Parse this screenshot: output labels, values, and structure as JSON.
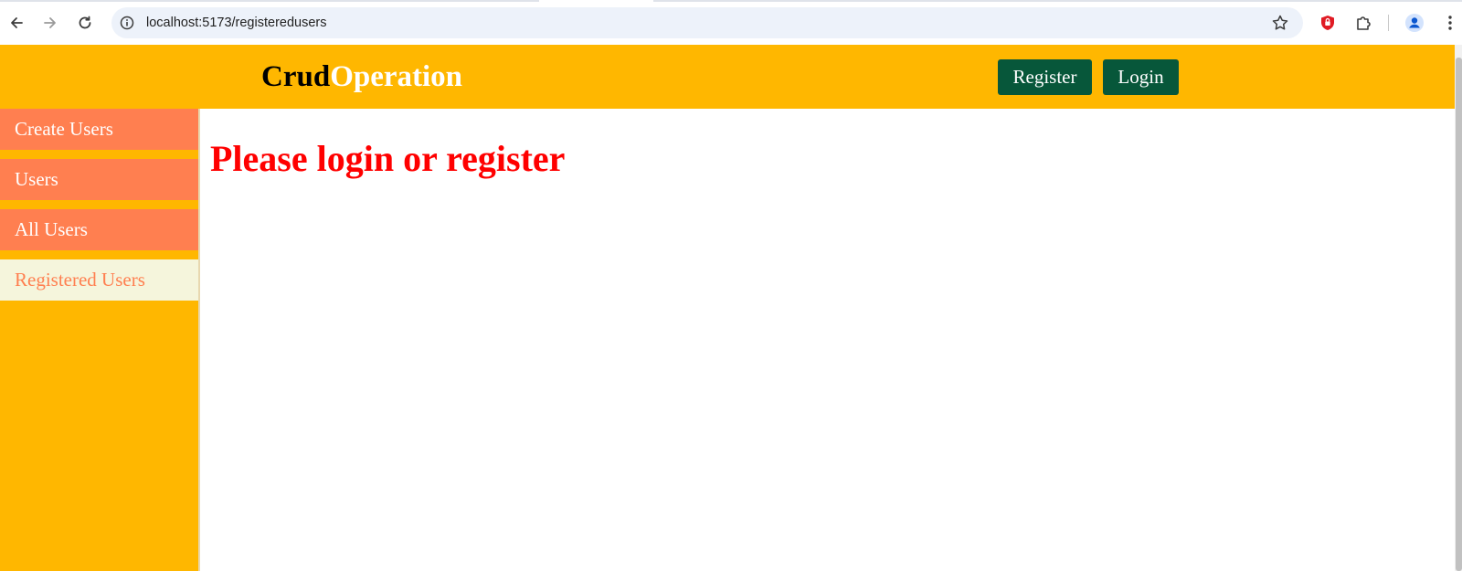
{
  "browser": {
    "url": "localhost:5173/registeredusers",
    "icons": [
      "back-arrow-icon",
      "forward-arrow-icon",
      "reload-icon",
      "site-info-icon",
      "bookmark-star-icon",
      "shield-extension-icon",
      "extensions-puzzle-icon",
      "profile-avatar-icon",
      "menu-kebab-icon"
    ]
  },
  "header": {
    "brand_part1": "Crud",
    "brand_part2": "Operation",
    "register_label": "Register",
    "login_label": "Login"
  },
  "sidebar": {
    "items": [
      {
        "label": "Create Users",
        "active": false
      },
      {
        "label": "Users",
        "active": false
      },
      {
        "label": "All Users",
        "active": false
      },
      {
        "label": "Registered Users",
        "active": true
      }
    ]
  },
  "main": {
    "message": "Please login or register"
  },
  "colors": {
    "header_bg": "#ffb700",
    "brand_dark": "#000000",
    "brand_light": "#ffffff",
    "button_bg": "#07573a",
    "sidebar_item": "#ff7f50",
    "sidebar_active_bg": "#f5f5dc",
    "message": "#ff0000"
  }
}
